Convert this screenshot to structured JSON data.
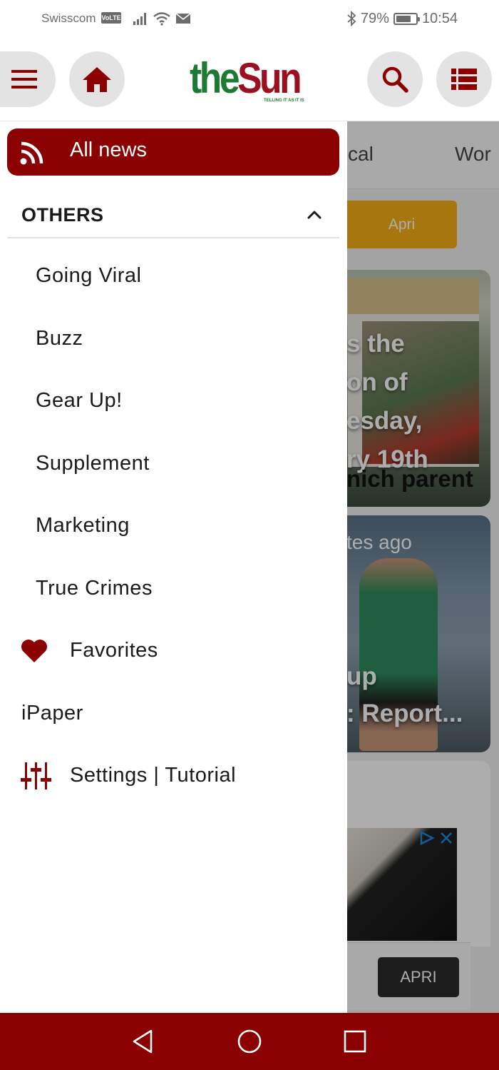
{
  "status_bar": {
    "carrier": "Swisscom",
    "volte": "VoLTE",
    "battery_percent": "79%",
    "battery_level": 0.79,
    "time": "10:54"
  },
  "header": {
    "logo": {
      "part1": "the",
      "part2": "Sun",
      "tagline": "TELLING IT AS IT IS"
    },
    "icons": [
      "menu-icon",
      "home-icon",
      "search-icon",
      "list-icon"
    ]
  },
  "drawer": {
    "all_news": {
      "icon": "rss-icon",
      "label": "All news"
    },
    "section": {
      "label": "OTHERS",
      "expanded": true
    },
    "items": [
      {
        "label": "Going Viral"
      },
      {
        "label": "Buzz"
      },
      {
        "label": "Gear Up!"
      },
      {
        "label": "Supplement"
      },
      {
        "label": "Marketing"
      },
      {
        "label": "True Crimes"
      }
    ],
    "favorites": {
      "icon": "heart-icon",
      "label": "Favorites"
    },
    "ipaper": {
      "label": "iPaper"
    },
    "settings": {
      "icon": "sliders-icon",
      "label": "Settings | Tutorial"
    }
  },
  "background": {
    "tabs": [
      "cal",
      "Wor"
    ],
    "date_pill": "Apri",
    "card1_lines": [
      "s the",
      "on of",
      "esday,",
      "ry 19th",
      "nich parent"
    ],
    "card2_meta": "tes ago",
    "card2_lines": [
      "up",
      ": Report..."
    ],
    "ad_button": "APRI"
  },
  "colors": {
    "brand": "#8b0000",
    "logo_green": "#1d7a33",
    "logo_red": "#9b1020",
    "pill_yellow": "#f3b015"
  },
  "nav_bar": {
    "icons": [
      "back-icon",
      "home-circle-icon",
      "recents-icon"
    ]
  }
}
